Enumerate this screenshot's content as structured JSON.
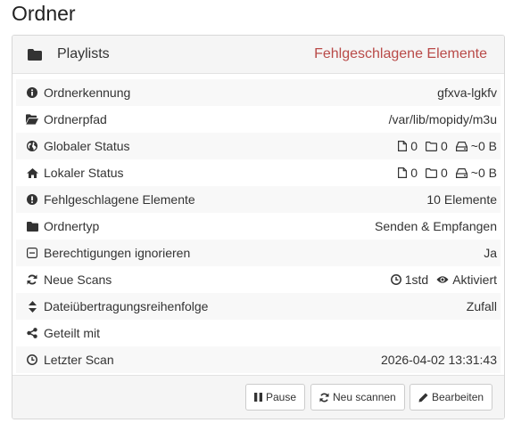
{
  "page": {
    "title": "Ordner"
  },
  "folder": {
    "name": "Playlists",
    "status": "Fehlgeschlagene Elemente",
    "status_color": "#b94a48",
    "rows": {
      "id": {
        "label": "Ordnerkennung",
        "value": "gfxva-lgkfv",
        "icon": "info-circle-icon"
      },
      "path": {
        "label": "Ordnerpfad",
        "value": "/var/lib/mopidy/m3u",
        "icon": "folder-open-icon"
      },
      "global": {
        "label": "Globaler Status",
        "files": "0",
        "dirs": "0",
        "size": "~0 B",
        "icon": "globe-icon"
      },
      "local": {
        "label": "Lokaler Status",
        "files": "0",
        "dirs": "0",
        "size": "~0 B",
        "icon": "home-icon"
      },
      "failed": {
        "label": "Fehlgeschlagene Elemente",
        "value": "10 Elemente",
        "icon": "exclamation-circle-icon"
      },
      "type": {
        "label": "Ordnertyp",
        "value": "Senden & Empfangen",
        "icon": "folder-icon"
      },
      "perms": {
        "label": "Berechtigungen ignorieren",
        "value": "Ja",
        "icon": "minus-square-icon"
      },
      "rescan": {
        "label": "Neue Scans",
        "interval": "1std",
        "watch": "Aktiviert",
        "icon": "refresh-icon"
      },
      "order": {
        "label": "Dateiübertragungsreihenfolge",
        "value": "Zufall",
        "icon": "sort-icon"
      },
      "shared": {
        "label": "Geteilt mit",
        "value": "",
        "icon": "share-icon"
      },
      "lastscan": {
        "label": "Letzter Scan",
        "value": "2026-04-02 13:31:43",
        "icon": "clock-icon"
      }
    }
  },
  "buttons": {
    "pause": "Pause",
    "rescan": "Neu scannen",
    "edit": "Bearbeiten"
  },
  "colors": {
    "link": "#337ab7",
    "header_bg": "#f5f5f5",
    "stripe": "#f8f8f8"
  }
}
